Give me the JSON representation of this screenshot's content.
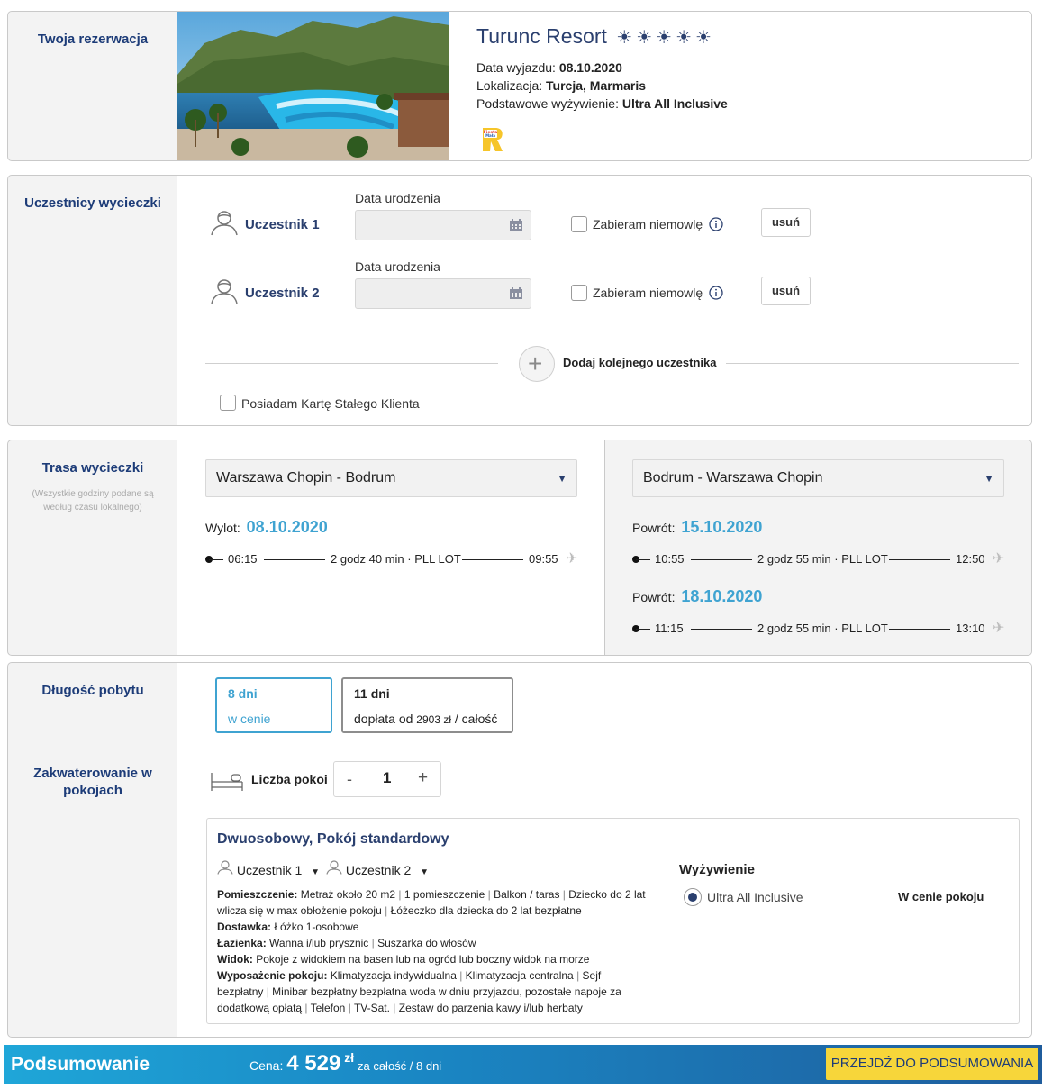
{
  "reservation": {
    "section_title": "Twoja rezerwacja",
    "hotel_name": "Turunc Resort",
    "stars": 5,
    "departure_label": "Data wyjazdu:",
    "departure_value": "08.10.2020",
    "location_label": "Lokalizacja:",
    "location_value": "Turcja, Marmaris",
    "board_label": "Podstawowe wyżywienie:",
    "board_value": "Ultra All Inclusive",
    "badge_text": "Fiesta Mała"
  },
  "participants": {
    "section_title": "Uczestnicy wycieczki",
    "list": [
      {
        "name": "Uczestnik 1",
        "dob_label": "Data urodzenia",
        "infant_label": "Zabieram niemowlę",
        "remove_label": "usuń"
      },
      {
        "name": "Uczestnik 2",
        "dob_label": "Data urodzenia",
        "infant_label": "Zabieram niemowlę",
        "remove_label": "usuń"
      }
    ],
    "add_label": "Dodaj kolejnego uczestnika",
    "loyalty_label": "Posiadam Kartę Stałego Klienta"
  },
  "route": {
    "section_title": "Trasa wycieczki",
    "note": "(Wszystkie godziny podane są według czasu lokalnego)",
    "outbound": {
      "select_value": "Warszawa Chopin - Bodrum",
      "legs": [
        {
          "label": "Wylot:",
          "date": "08.10.2020",
          "dep": "06:15",
          "info": "2 godz 40 min · PLL LOT",
          "arr": "09:55"
        }
      ]
    },
    "return": {
      "select_value": "Bodrum - Warszawa Chopin",
      "legs": [
        {
          "label": "Powrót:",
          "date": "15.10.2020",
          "dep": "10:55",
          "info": "2 godz 55 min · PLL LOT",
          "arr": "12:50"
        },
        {
          "label": "Powrót:",
          "date": "18.10.2020",
          "dep": "11:15",
          "info": "2 godz 55 min · PLL LOT",
          "arr": "13:10"
        }
      ]
    }
  },
  "stay": {
    "section_title": "Długość pobytu",
    "options": [
      {
        "title": "8 dni",
        "subtitle": "w cenie",
        "selected": true
      },
      {
        "title": "11 dni",
        "subtitle_prefix": "dopłata od",
        "amount": "2903 zł",
        "subtitle_suffix": "/ całość",
        "selected": false
      }
    ]
  },
  "accommodation": {
    "section_title": "Zakwaterowanie w pokojach",
    "rooms_label": "Liczba pokoi",
    "rooms_count": "1",
    "minus": "-",
    "plus": "+",
    "room_title": "Dwuosobowy, Pokój standardowy",
    "room_participants": [
      "Uczestnik 1",
      "Uczestnik 2"
    ],
    "details": [
      {
        "label": "Pomieszczenie:",
        "items": [
          "Metraż około 20 m2",
          "1 pomieszczenie",
          "Balkon / taras",
          "Dziecko do 2 lat wlicza się w max obłożenie pokoju",
          "Łóżeczko dla dziecka do 2 lat bezpłatne"
        ]
      },
      {
        "label": "Dostawka:",
        "items": [
          "Łóżko 1-osobowe"
        ]
      },
      {
        "label": "Łazienka:",
        "items": [
          "Wanna i/lub prysznic",
          "Suszarka do włosów"
        ]
      },
      {
        "label": "Widok:",
        "items": [
          "Pokoje z widokiem na basen lub na ogród lub boczny widok na morze"
        ]
      },
      {
        "label": "Wyposażenie pokoju:",
        "items": [
          "Klimatyzacja indywidualna",
          "Klimatyzacja centralna",
          "Sejf bezpłatny",
          "Minibar bezpłatny bezpłatna woda w dniu przyjazdu, pozostałe napoje za dodatkową opłatą",
          "Telefon",
          "TV-Sat.",
          "Zestaw do parzenia kawy i/lub herbaty"
        ]
      }
    ],
    "board_title": "Wyżywienie",
    "board_option": "Ultra All Inclusive",
    "board_price": "W cenie pokoju"
  },
  "summary": {
    "title": "Podsumowanie",
    "price_label": "Cena:",
    "price_value": "4 529",
    "currency": "zł",
    "price_suffix": "za całość / 8 dni",
    "cta": "PRZEJDŹ DO PODSUMOWANIA"
  },
  "colors": {
    "navy": "#1d3c78",
    "accent_blue": "#3fa3d1",
    "cta_yellow": "#f7d63a",
    "summary_gradient_start": "#1a9bd0",
    "summary_gradient_end": "#1a5f9e"
  }
}
